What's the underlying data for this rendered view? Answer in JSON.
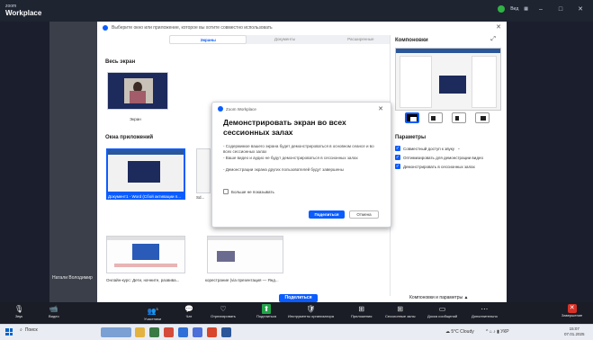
{
  "app": {
    "logo_line1": "zoom",
    "logo_line2": "Workplace",
    "view_label": "Вид"
  },
  "titlebar": {
    "minimize": "–",
    "maximize": "□",
    "close": "✕"
  },
  "share_panel": {
    "header_text": "Выберите окно или приложение, которое вы хотите совместно использовать",
    "tabs": [
      {
        "label": "Экраны",
        "active": true
      },
      {
        "label": "Документы",
        "active": false
      },
      {
        "label": "Расширенные",
        "active": false
      }
    ],
    "whole_screen_title": "Весь экран",
    "screen_label": "Экран",
    "app_windows_title": "Окна приложений",
    "windows": [
      {
        "label": "Документ1 - Word (Сбой активации п..."
      },
      {
        "label": "Sd..."
      },
      {
        "label": "Онлайн-курс: Дети, начните, развива..."
      },
      {
        "label": "корестрание (via презентация — Янд..."
      }
    ],
    "share_button": "Поделиться",
    "layout_params": "Компоновки и параметры ▲"
  },
  "right_panel": {
    "title": "Компоновки",
    "params_title": "Параметры",
    "options": [
      {
        "label": "Совместный доступ к звуку",
        "checked": true
      },
      {
        "label": "Оптимизировать для демонстрации видео",
        "checked": true
      },
      {
        "label": "Демонстрировать в сессионных залах",
        "checked": true
      }
    ]
  },
  "modal": {
    "header": "Zoom Workplace",
    "title": "Демонстрировать экран во всех сессионных залах",
    "bullets": [
      "- Содержимое вашего экрана будет демонстрироваться в основном сеансе и во всех сессионных залах",
      "- Ваше видео и аудио не будут демонстрироваться в сессионных залах",
      "- Демонстрации экрана других пользователей будут завершены"
    ],
    "dont_show": "Больше не показывать",
    "share_button": "Поделиться",
    "cancel_button": "Отмена"
  },
  "participant_name": "Натали Володимир",
  "toolbar": [
    {
      "name": "audio",
      "label": "Звук",
      "icon": "🎙"
    },
    {
      "name": "video",
      "label": "Видео",
      "icon": "📹"
    },
    {
      "name": "participants",
      "label": "Участники",
      "icon": "👥",
      "count": "3"
    },
    {
      "name": "chat",
      "label": "Чат",
      "icon": "💬"
    },
    {
      "name": "react",
      "label": "Отреагировать",
      "icon": "♡"
    },
    {
      "name": "share",
      "label": "Поделиться",
      "icon": "⬆"
    },
    {
      "name": "host-tools",
      "label": "Инструменты организатора",
      "icon": "🛡"
    },
    {
      "name": "apps",
      "label": "Приложения",
      "icon": "⊞"
    },
    {
      "name": "breakout",
      "label": "Сессионные залы",
      "icon": "⊞"
    },
    {
      "name": "docs",
      "label": "Доска сообщений",
      "icon": "▭"
    },
    {
      "name": "more",
      "label": "Дополнительно",
      "icon": "⋯"
    },
    {
      "name": "end",
      "label": "Завершение",
      "icon": "✕"
    }
  ],
  "taskbar": {
    "search": "Поиск",
    "weather": "5°C Cloudy",
    "lang": "УКР",
    "time": "15:07",
    "date": "07.01.2025"
  },
  "colors": {
    "accent": "#0b5cff",
    "toolbar": "#1a1d26",
    "share_green": "#23a44a",
    "end_red": "#d93025"
  }
}
